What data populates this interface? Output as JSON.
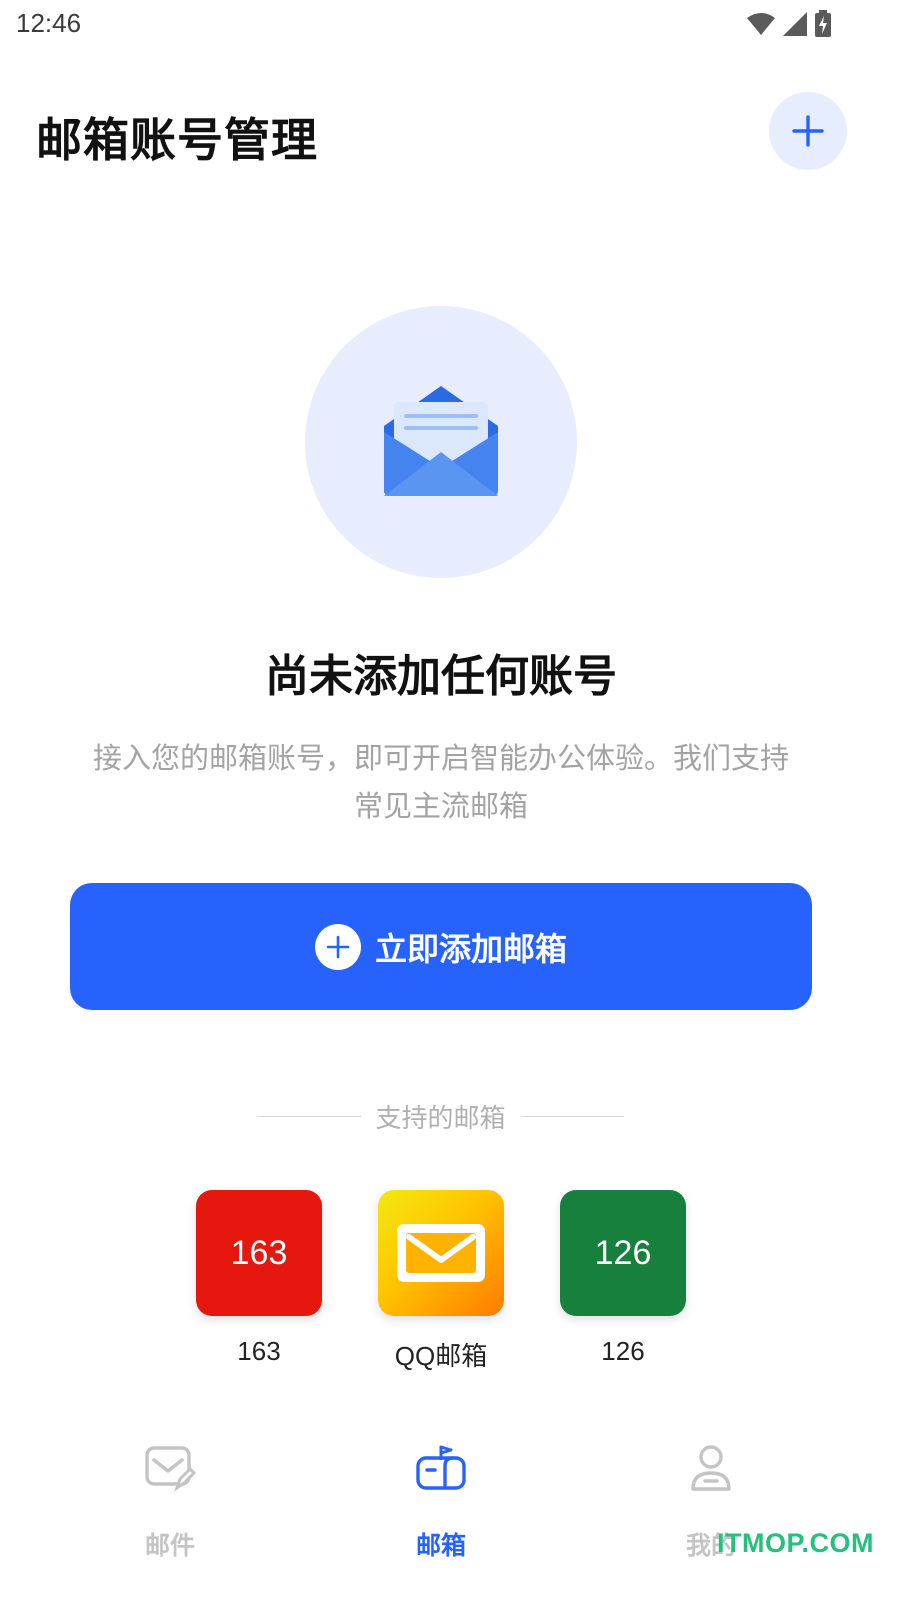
{
  "status_bar": {
    "time": "12:46",
    "icons": [
      "wifi-icon",
      "signal-icon",
      "battery-charging-icon"
    ]
  },
  "header": {
    "title": "邮箱账号管理",
    "add_icon": "plus-icon"
  },
  "empty_state": {
    "icon": "open-envelope-icon",
    "title": "尚未添加任何账号",
    "description": "接入您的邮箱账号，即可开启智能办公体验。我们支持常见主流邮箱"
  },
  "primary_action": {
    "label": "立即添加邮箱",
    "icon": "plus-circle-icon"
  },
  "supported": {
    "heading": "支持的邮箱",
    "providers": [
      {
        "tile_text": "163",
        "name": "163",
        "color": "#e5170f"
      },
      {
        "tile_text": "",
        "name": "QQ邮箱",
        "color": "#ffa800",
        "icon": "envelope-icon"
      },
      {
        "tile_text": "126",
        "name": "126",
        "color": "#17803d"
      }
    ]
  },
  "tab_bar": {
    "tabs": [
      {
        "label": "邮件",
        "icon": "mail-edit-icon",
        "active": false
      },
      {
        "label": "邮箱",
        "icon": "mailbox-icon",
        "active": true
      },
      {
        "label": "我的",
        "icon": "user-icon",
        "active": false
      }
    ]
  },
  "colors": {
    "accent": "#2762fc",
    "accent_light": "#e6edff",
    "inactive": "#c4c4c4"
  },
  "watermark": "ITMOP.COM"
}
